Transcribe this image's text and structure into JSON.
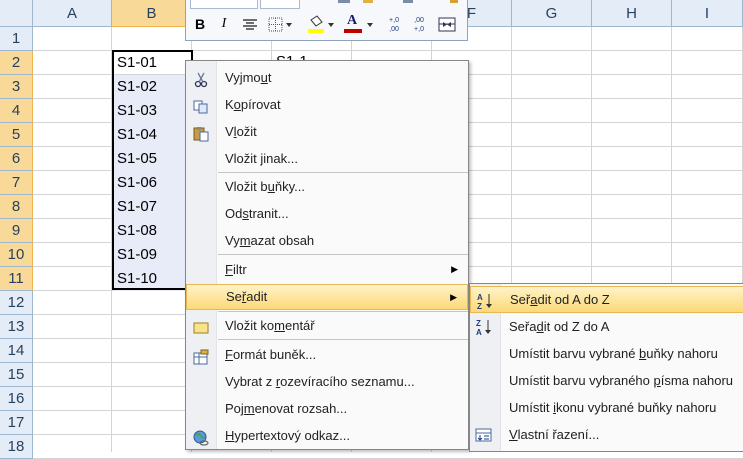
{
  "columns": [
    "A",
    "B",
    "C",
    "D",
    "E",
    "F",
    "G",
    "H",
    "I"
  ],
  "rows": [
    "1",
    "2",
    "3",
    "4",
    "5",
    "6",
    "7",
    "8",
    "9",
    "10",
    "11",
    "12",
    "13",
    "14",
    "15",
    "16",
    "17",
    "18"
  ],
  "cells_b": [
    "S1-01",
    "S1-02",
    "S1-03",
    "S1-04",
    "S1-05",
    "S1-06",
    "S1-07",
    "S1-08",
    "S1-09",
    "S1-10"
  ],
  "partial_d2": "S1-1",
  "mini_toolbar": {
    "bold": "B",
    "italic": "I",
    "font_color_letter": "A",
    "increase_decimal": "+,0 ,00",
    "decrease_decimal": ",00 +,0"
  },
  "context_menu": {
    "cut": {
      "pre": "Vyjmo",
      "u": "u",
      "post": "t"
    },
    "copy": {
      "pre": "K",
      "u": "o",
      "post": "pírovat"
    },
    "paste": {
      "pre": "V",
      "u": "l",
      "post": "ožit"
    },
    "paste_special": {
      "pre": "Vložit ",
      "u": "j",
      "post": "inak..."
    },
    "insert_cells": {
      "pre": "Vložit b",
      "u": "u",
      "post": "ňky..."
    },
    "delete": {
      "pre": "Od",
      "u": "s",
      "post": "tranit..."
    },
    "clear": {
      "pre": "Vy",
      "u": "m",
      "post": "azat obsah"
    },
    "filter": {
      "pre": "",
      "u": "F",
      "post": "iltr"
    },
    "sort": {
      "pre": "Se",
      "u": "ř",
      "post": "adit"
    },
    "insert_comment": {
      "pre": "Vložit ko",
      "u": "m",
      "post": "entář"
    },
    "format_cells": {
      "pre": "",
      "u": "F",
      "post": "ormát buněk..."
    },
    "pick_list": {
      "pre": "Vybrat z ",
      "u": "r",
      "post": "ozevíracího seznamu..."
    },
    "name_range": {
      "pre": "Poj",
      "u": "m",
      "post": "enovat rozsah..."
    },
    "hyperlink": {
      "pre": "",
      "u": "H",
      "post": "ypertextový odkaz..."
    }
  },
  "sort_submenu": {
    "a_to_z": {
      "pre": "Seř",
      "u": "a",
      "post": "dit od A do Z"
    },
    "z_to_a": {
      "pre": "Seřa",
      "u": "d",
      "post": "it od Z do A"
    },
    "cell_color": {
      "pre": "Umístit barvu vybrané ",
      "u": "b",
      "post": "uňky nahoru"
    },
    "font_color": {
      "pre": "Umístit barvu vybraného ",
      "u": "p",
      "post": "ísma nahoru"
    },
    "cell_icon": {
      "pre": "Umístit ",
      "u": "i",
      "post": "konu vybrané buňky nahoru"
    },
    "custom": {
      "pre": "",
      "u": "V",
      "post": "lastní řazení..."
    }
  },
  "colors": {
    "highlight": "#fcd978",
    "header_selected": "#f8d998",
    "header": "#e4ecf7"
  }
}
